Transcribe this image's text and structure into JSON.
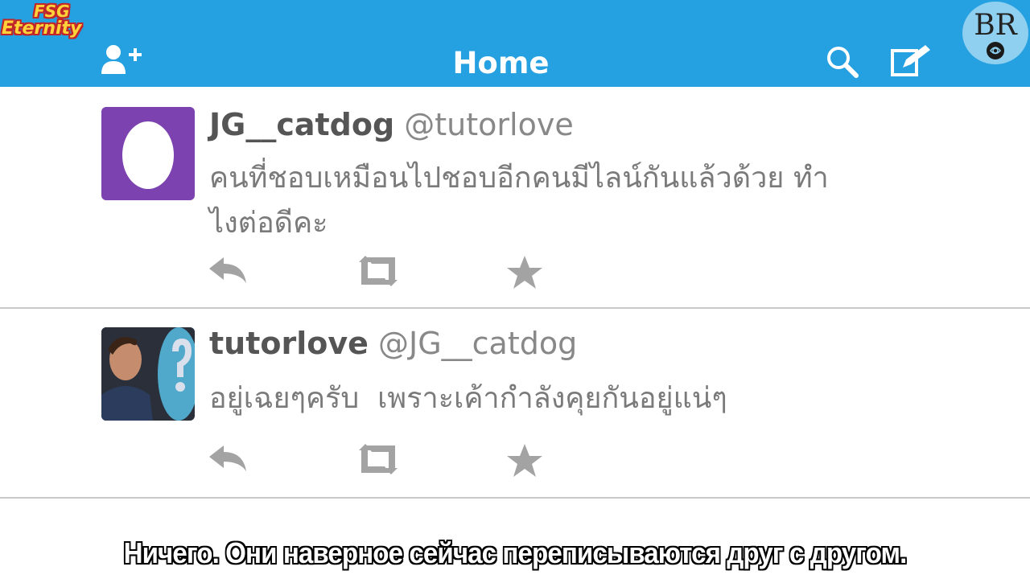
{
  "header": {
    "title": "Home",
    "left_icon": "add-user-icon",
    "right_icons": [
      "search-icon",
      "compose-icon"
    ],
    "color": "#25a0e0"
  },
  "watermark": {
    "line1": "FSG",
    "line2": "Eternity"
  },
  "logo": {
    "text": "BR"
  },
  "tweets": [
    {
      "display_name": "JG__catdog",
      "handle": "@tutorlove",
      "text": "คนที่ชอบเหมือนไปชอบอีกคนมีไลน์กันแล้วด้วย ทำไงต่อดีคะ",
      "avatar": "egg-avatar-icon"
    },
    {
      "display_name": "tutorlove",
      "handle": "@JG__catdog",
      "text": "อยู่เฉยๆครับ  เพราะเค้ากำลังคุยกันอยู่แน่ๆ",
      "avatar": "profile-photo"
    }
  ],
  "actions": [
    "reply-icon",
    "retweet-icon",
    "favorite-icon"
  ],
  "subtitle": "Ничего. Они наверное сейчас переписываются друг с другом."
}
